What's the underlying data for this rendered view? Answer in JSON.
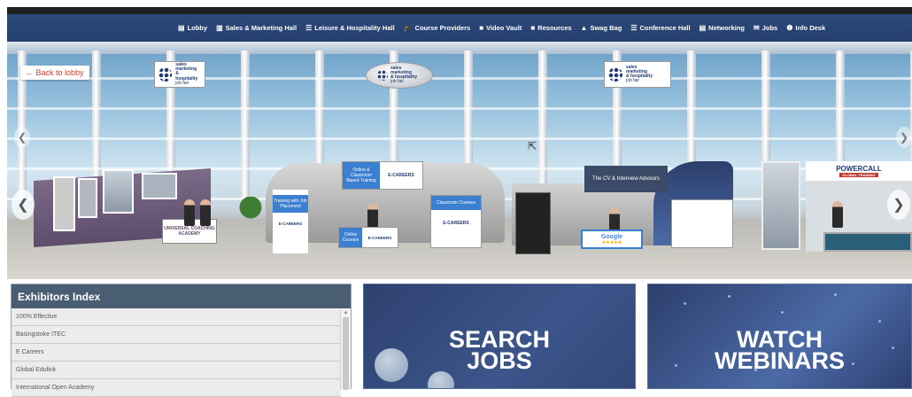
{
  "nav": {
    "items": [
      {
        "icon": "document-icon",
        "glyph": "▤",
        "label": "Lobby"
      },
      {
        "icon": "building-icon",
        "glyph": "▥",
        "label": "Sales & Marketing Hall"
      },
      {
        "icon": "list-icon",
        "glyph": "☰",
        "label": "Leisure & Hospitality Hall"
      },
      {
        "icon": "graduation-cap-icon",
        "glyph": "🎓",
        "label": "Course Providers"
      },
      {
        "icon": "video-camera-icon",
        "glyph": "■",
        "label": "Video Vault"
      },
      {
        "icon": "book-icon",
        "glyph": "■",
        "label": "Resources"
      },
      {
        "icon": "bag-icon",
        "glyph": "▲",
        "label": "Swag Bag"
      },
      {
        "icon": "list-icon",
        "glyph": "☰",
        "label": "Conference Hall"
      },
      {
        "icon": "document-icon",
        "glyph": "▤",
        "label": "Networking"
      },
      {
        "icon": "envelope-icon",
        "glyph": "✉",
        "label": "Jobs"
      },
      {
        "icon": "info-circle-icon",
        "glyph": "❶",
        "label": "Info Desk"
      }
    ]
  },
  "hall": {
    "back_label": "← Back to lobby",
    "sign_text": [
      "sales",
      "marketing",
      "& hospitality",
      "job fair"
    ],
    "booths": {
      "training_panel": "Training with Job Placement",
      "online_classroom": "Online & Classroom Based Training",
      "classroom_courses": "Classroom Courses",
      "online_courses": "Online Courses",
      "ecareers": "E-CAREERS",
      "interview_advisors": "The CV & Interview Advisors",
      "powercall": "POWERCALL",
      "powercall_sub": "GLOBAL TRAINING",
      "universal": "UNIVERSAL COACHING ACADEMY",
      "google": "Google",
      "stars": "★★★★★"
    }
  },
  "exhibitors": {
    "title": "Exhibitors Index",
    "items": [
      "100% Effective",
      "Basingstoke ITEC",
      "E Careers",
      "Global Edulink",
      "International Open Academy"
    ]
  },
  "tiles": {
    "jobs": [
      "SEARCH",
      "JOBS"
    ],
    "webinars": [
      "WATCH",
      "WEBINARS"
    ]
  },
  "colors": {
    "nav_bg": "#2d4a7c",
    "exhibitor_header": "#4a5e73",
    "back_text": "#d63a2b",
    "booth_blue": "#3a7fd0"
  }
}
